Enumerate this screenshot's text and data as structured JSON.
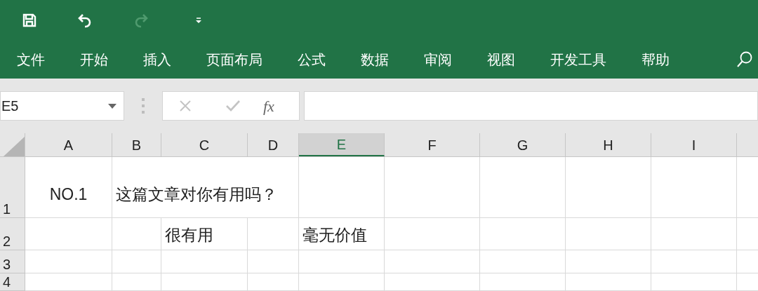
{
  "quick_access": [
    {
      "kind": "save",
      "disabled": false
    },
    {
      "kind": "undo",
      "disabled": false
    },
    {
      "kind": "redo",
      "disabled": true
    },
    {
      "kind": "customize",
      "disabled": false
    }
  ],
  "ribbon_tabs": [
    {
      "label": "文件"
    },
    {
      "label": "开始"
    },
    {
      "label": "插入"
    },
    {
      "label": "页面布局"
    },
    {
      "label": "公式"
    },
    {
      "label": "数据"
    },
    {
      "label": "审阅"
    },
    {
      "label": "视图"
    },
    {
      "label": "开发工具"
    },
    {
      "label": "帮助"
    }
  ],
  "name_box": {
    "value": "E5"
  },
  "formula_bar": {
    "function_label": "fx"
  },
  "columns": [
    {
      "label": "A",
      "selected": false
    },
    {
      "label": "B",
      "selected": false
    },
    {
      "label": "C",
      "selected": false
    },
    {
      "label": "D",
      "selected": false
    },
    {
      "label": "E",
      "selected": true
    },
    {
      "label": "F",
      "selected": false
    },
    {
      "label": "G",
      "selected": false
    },
    {
      "label": "H",
      "selected": false
    },
    {
      "label": "I",
      "selected": false
    }
  ],
  "rows": [
    {
      "header": "1",
      "cells": [
        {
          "text": "NO.1",
          "centered": true
        },
        {
          "text": "这篇文章对你有用吗？",
          "centered": false
        },
        null,
        null,
        null,
        null,
        null,
        null,
        null
      ]
    },
    {
      "header": "2",
      "cells": [
        null,
        null,
        {
          "text": "很有用",
          "centered": false
        },
        null,
        {
          "text": "毫无价值",
          "centered": false
        },
        null,
        null,
        null,
        null
      ]
    },
    {
      "header": "3",
      "cells": [
        null,
        null,
        null,
        null,
        null,
        null,
        null,
        null,
        null
      ]
    },
    {
      "header": "4",
      "cells": [
        null,
        null,
        null,
        null,
        null,
        null,
        null,
        null,
        null
      ]
    }
  ]
}
